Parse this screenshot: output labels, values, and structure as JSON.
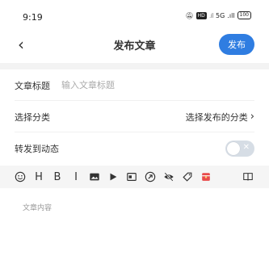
{
  "status_bar": {
    "time": "9:19",
    "hd_label": "HD",
    "network": "5G",
    "battery": "100"
  },
  "nav": {
    "back_icon": "chevron-left-icon",
    "title": "发布文章",
    "publish_label": "发布",
    "accent_color": "#2f7de1"
  },
  "form": {
    "title_label": "文章标题",
    "title_placeholder": "输入文章标题",
    "category_label": "选择分类",
    "category_value": "选择发布的分类",
    "forward_label": "转发到动态",
    "forward_enabled": false
  },
  "toolbar": {
    "bold": "B",
    "heading": "H",
    "italic": "I",
    "icons": [
      "emoji-icon",
      "heading-icon",
      "bold-icon",
      "italic-icon",
      "image-icon",
      "video-icon",
      "card-icon",
      "link-icon",
      "hide-icon",
      "tag-icon",
      "red-packet-icon",
      "book-icon"
    ]
  },
  "editor": {
    "placeholder": "文章内容"
  }
}
